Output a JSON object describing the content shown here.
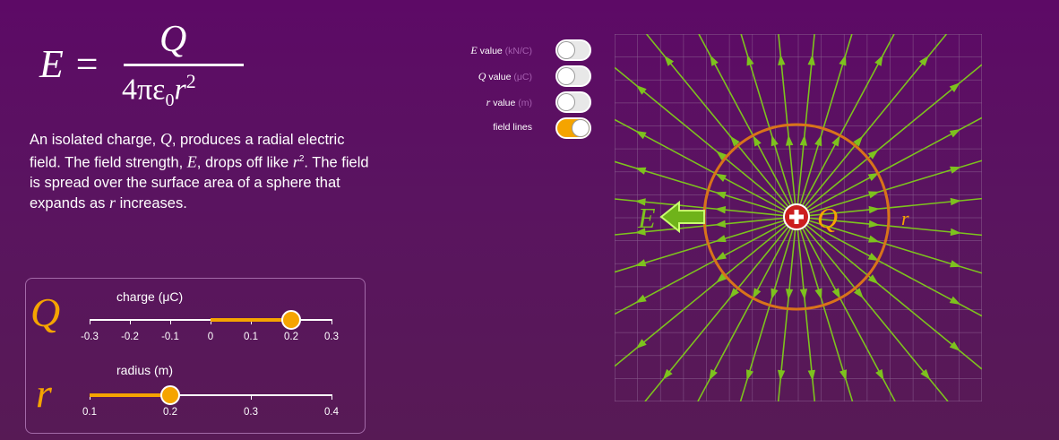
{
  "formula": {
    "lhs": "E =",
    "numerator": "Q",
    "denominator_prefix": "4πε",
    "denominator_sub": "0",
    "denominator_r": "r",
    "denominator_sup": "2"
  },
  "description": {
    "p1": "An isolated charge, ",
    "Q": "Q",
    "p2": ", produces a radial electric field.  The field strength, ",
    "E": "E",
    "p3": ", drops off like ",
    "r": "r",
    "p4": ". The field is spread over the surface area of a sphere that expands as ",
    "r2": "r",
    "p5": " increases."
  },
  "toggles": [
    {
      "var": "E",
      "text": " value ",
      "unit": "(kN/C)",
      "on": false
    },
    {
      "var": "Q",
      "text": " value ",
      "unit": "(μC)",
      "on": false
    },
    {
      "var": "r",
      "text": " value ",
      "unit": "(m)",
      "on": false
    },
    {
      "var": "",
      "text": "field lines",
      "unit": "",
      "on": true
    }
  ],
  "sliders": {
    "charge": {
      "symbol": "Q",
      "label": "charge (μC)",
      "ticks": [
        "-0.3",
        "-0.2",
        "-0.1",
        "0",
        "0.1",
        "0.2",
        "0.3"
      ],
      "min": -0.3,
      "max": 0.3,
      "value": 0.2
    },
    "radius": {
      "symbol": "r",
      "label": "radius (m)",
      "ticks": [
        "0.1",
        "0.2",
        "0.3",
        "0.4"
      ],
      "min": 0.1,
      "max": 0.4,
      "value": 0.2
    }
  },
  "diagram": {
    "E_label": "E",
    "Q_label": "Q",
    "r_label": "r",
    "charge_sign": "+",
    "field_line_count": 32,
    "colors": {
      "field": "#7dc21e",
      "circle": "#d9731a",
      "label": "#f5a400",
      "charge": "#cc1e1e",
      "grid": "#8a5d8f"
    }
  }
}
